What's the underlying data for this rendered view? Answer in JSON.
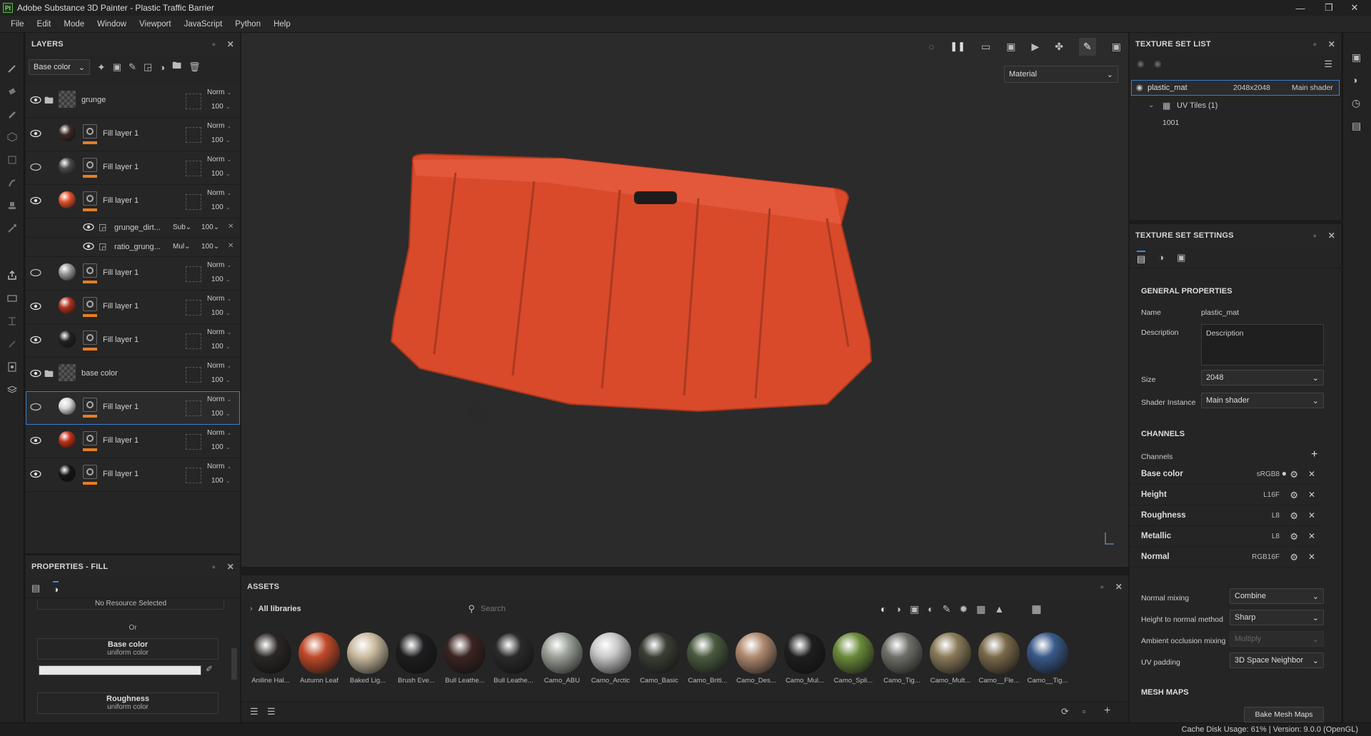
{
  "app": {
    "title": "Adobe Substance 3D Painter - Plastic Traffic Barrier",
    "logo": "Pt"
  },
  "menu": [
    "File",
    "Edit",
    "Mode",
    "Window",
    "Viewport",
    "JavaScript",
    "Python",
    "Help"
  ],
  "layers_panel": {
    "title": "LAYERS",
    "channel_select": "Base color",
    "rows": [
      {
        "type": "folder",
        "name": "grunge",
        "blend": "Norm",
        "opacity": "100",
        "thumb": "checker",
        "visible": true,
        "selected": false
      },
      {
        "type": "fill",
        "name": "Fill layer 1",
        "blend": "Norm",
        "opacity": "100",
        "thumb": "#3a2a26",
        "visible": true,
        "selected": false
      },
      {
        "type": "fill",
        "name": "Fill layer 1",
        "blend": "Norm",
        "opacity": "100",
        "thumb": "#4a4a4a",
        "visible": false,
        "selected": false
      },
      {
        "type": "fill",
        "name": "Fill layer 1",
        "blend": "Norm",
        "opacity": "100",
        "thumb": "#e0512c",
        "visible": true,
        "selected": false
      },
      {
        "type": "fill",
        "name": "Fill layer 1",
        "blend": "Norm",
        "opacity": "100",
        "thumb": "#9a9a9a",
        "visible": false,
        "selected": false
      },
      {
        "type": "fill",
        "name": "Fill layer 1",
        "blend": "Norm",
        "opacity": "100",
        "thumb": "#b0321f",
        "visible": true,
        "selected": false
      },
      {
        "type": "fill",
        "name": "Fill layer 1",
        "blend": "Norm",
        "opacity": "100",
        "thumb": "#222222",
        "visible": true,
        "selected": false
      },
      {
        "type": "folder",
        "name": "base color",
        "blend": "Norm",
        "opacity": "100",
        "thumb": "checker",
        "visible": true,
        "selected": false
      },
      {
        "type": "fill",
        "name": "Fill layer 1",
        "blend": "Norm",
        "opacity": "100",
        "thumb": "#d8d8d8",
        "visible": false,
        "selected": true
      },
      {
        "type": "fill",
        "name": "Fill layer 1",
        "blend": "Norm",
        "opacity": "100",
        "thumb": "#c0301c",
        "visible": true,
        "selected": false
      },
      {
        "type": "fill",
        "name": "Fill layer 1",
        "blend": "Norm",
        "opacity": "100",
        "thumb": "#151515",
        "visible": true,
        "selected": false
      }
    ],
    "effects": [
      {
        "name": "grunge_dirt...",
        "blend": "Sub",
        "opacity": "100"
      },
      {
        "name": "ratio_grung...",
        "blend": "Mul",
        "opacity": "100"
      }
    ]
  },
  "properties": {
    "title": "PROPERTIES - FILL",
    "no_resource": "No Resource Selected",
    "or": "Or",
    "base_color_title": "Base color",
    "base_color_sub": "uniform color",
    "roughness_title": "Roughness",
    "roughness_sub": "uniform color"
  },
  "viewport": {
    "mode_select": "Material",
    "barrier_color": "#e0512c"
  },
  "assets": {
    "title": "ASSETS",
    "library": "All libraries",
    "search_placeholder": "Search",
    "materials": [
      {
        "name": "Aniline Hal...",
        "color": "#2a2624"
      },
      {
        "name": "Autumn Leaf",
        "color": "#c04a2a"
      },
      {
        "name": "Baked Lig...",
        "color": "#cbbba0"
      },
      {
        "name": "Brush Eve...",
        "color": "#1e1e20"
      },
      {
        "name": "Bull Leathe...",
        "color": "#3a2420"
      },
      {
        "name": "Bull Leathe...",
        "color": "#2a2a2a"
      },
      {
        "name": "Camo_ABU",
        "color": "#9aa098"
      },
      {
        "name": "Camo_Arctic",
        "color": "#c8c8c8"
      },
      {
        "name": "Camo_Basic",
        "color": "#3a3e34"
      },
      {
        "name": "Camo_Briti...",
        "color": "#4a5a40"
      },
      {
        "name": "Camo_Des...",
        "color": "#b08a70"
      },
      {
        "name": "Camo_Mul...",
        "color": "#1e1e1e"
      },
      {
        "name": "Camo_Spli...",
        "color": "#6a8a3a"
      },
      {
        "name": "Camo_Tig...",
        "color": "#6e7068"
      },
      {
        "name": "Camo_Mult...",
        "color": "#8a7a5a"
      },
      {
        "name": "Camo__Fle...",
        "color": "#7a6a4a"
      },
      {
        "name": "Camo__Tig...",
        "color": "#3a5a8a"
      }
    ]
  },
  "texture_set_list": {
    "title": "TEXTURE SET LIST",
    "set_name": "plastic_mat",
    "set_size": "2048x2048",
    "set_shader": "Main shader",
    "uv_tiles": "UV Tiles (1)",
    "tile": "1001"
  },
  "texture_set_settings": {
    "title": "TEXTURE SET SETTINGS",
    "general": "GENERAL PROPERTIES",
    "name_label": "Name",
    "name_value": "plastic_mat",
    "desc_label": "Description",
    "desc_value": "Description",
    "size_label": "Size",
    "size_value": "2048",
    "shader_label": "Shader Instance",
    "shader_value": "Main shader",
    "channels_header": "CHANNELS",
    "channels_label": "Channels",
    "channels": [
      {
        "name": "Base color",
        "format": "sRGB8"
      },
      {
        "name": "Height",
        "format": "L16F"
      },
      {
        "name": "Roughness",
        "format": "L8"
      },
      {
        "name": "Metallic",
        "format": "L8"
      },
      {
        "name": "Normal",
        "format": "RGB16F"
      }
    ],
    "normal_mixing_label": "Normal mixing",
    "normal_mixing_value": "Combine",
    "h2n_label": "Height to normal method",
    "h2n_value": "Sharp",
    "ao_label": "Ambient occlusion mixing",
    "ao_value": "Multiply",
    "uv_pad_label": "UV padding",
    "uv_pad_value": "3D Space Neighbor",
    "mesh_maps": "MESH MAPS",
    "bake_button": "Bake Mesh Maps"
  },
  "status": "Cache Disk Usage:   61% | Version: 9.0.0 (OpenGL)"
}
